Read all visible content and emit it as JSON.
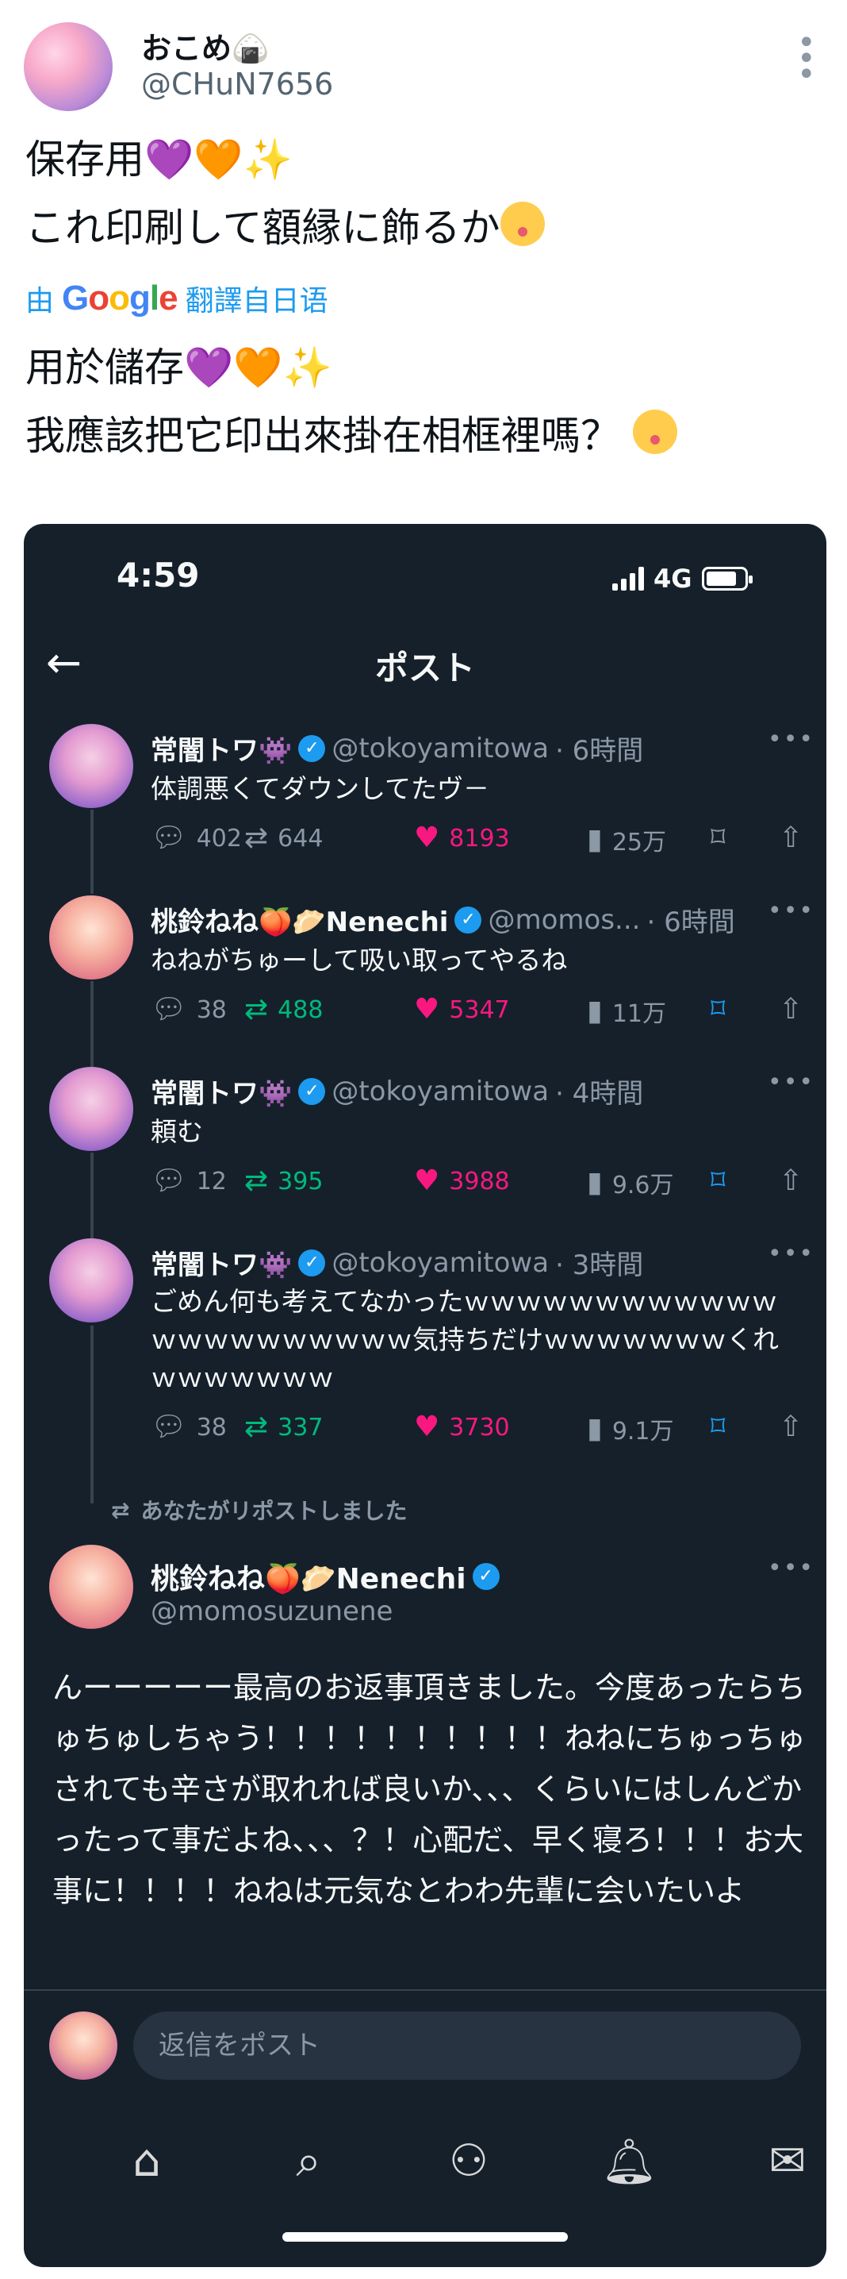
{
  "outer_tweet": {
    "display_name": "おこめ🍙",
    "handle": "@CHuN7656",
    "more_icon": "⋮",
    "original_text": {
      "line1_text": "保存用",
      "line1_emoji": [
        "💜",
        "🧡",
        "✨"
      ],
      "line2_text": "これ印刷して額縁に飾るか"
    },
    "translation_label_prefix": "由",
    "translation_provider": "Google",
    "translation_label_suffix": "翻譯自日语",
    "translated_text": {
      "line1_text": "用於儲存",
      "line2_text": "我應該把它印出來掛在相框裡嗎？"
    }
  },
  "embedded_screenshot": {
    "status_bar": {
      "time": "4:59",
      "network": "4G"
    },
    "header": {
      "back_icon": "←",
      "title": "ポスト"
    },
    "thread": [
      {
        "name": "常闇トワ👾",
        "handle": "@tokoyamitowa",
        "time": "· 6時間",
        "text": "体調悪くてダウンしてたヴ－",
        "replies": "402",
        "reposts": "644",
        "likes": "8193",
        "views": "25万",
        "reposted": false,
        "bookmarked": false
      },
      {
        "name": "桃鈴ねね🍑🥟Nenechi",
        "handle": "@momos...",
        "time": "· 6時間",
        "text": "ねねがちゅーして吸い取ってやるね",
        "replies": "38",
        "reposts": "488",
        "likes": "5347",
        "views": "11万",
        "reposted": true,
        "bookmarked": true
      },
      {
        "name": "常闇トワ👾",
        "handle": "@tokoyamitowa",
        "time": "· 4時間",
        "text": "頼む",
        "replies": "12",
        "reposts": "395",
        "likes": "3988",
        "views": "9.6万",
        "reposted": true,
        "bookmarked": true
      },
      {
        "name": "常闇トワ👾",
        "handle": "@tokoyamitowa",
        "time": "· 3時間",
        "text": "ごめん何も考えてなかったｗｗｗｗｗｗｗｗｗｗｗｗｗｗｗｗｗｗｗｗｗｗ気持ちだけｗｗｗｗｗｗｗくれｗｗｗｗｗｗｗ",
        "replies": "38",
        "reposts": "337",
        "likes": "3730",
        "views": "9.1万",
        "reposted": true,
        "bookmarked": true
      }
    ],
    "repost_banner": "あなたがリポストしました",
    "main_post": {
      "name": "桃鈴ねね🍑🥟Nenechi",
      "handle": "@momosuzunene",
      "text": "んーーーーー最高のお返事頂きました。今度あったらちゅちゅしちゃう！！！！！！！！！！ねねにちゅっちゅされても辛さが取れれば良いか、、、くらいにはしんどかったって事だよね、、、？！心配だ、早く寝ろ！！！お大事に！！！！ねねは元気なとわわ先輩に会いたいよ"
    },
    "reply_placeholder": "返信をポスト",
    "tabs": [
      "home-icon",
      "search-icon",
      "communities-icon",
      "notifications-icon",
      "messages-icon"
    ]
  },
  "colors": {
    "dark_bg": "#15202b",
    "accent_blue": "#1d9bf0",
    "repost_green": "#00ba7c",
    "like_pink": "#f91880",
    "muted": "#8b98a5"
  }
}
